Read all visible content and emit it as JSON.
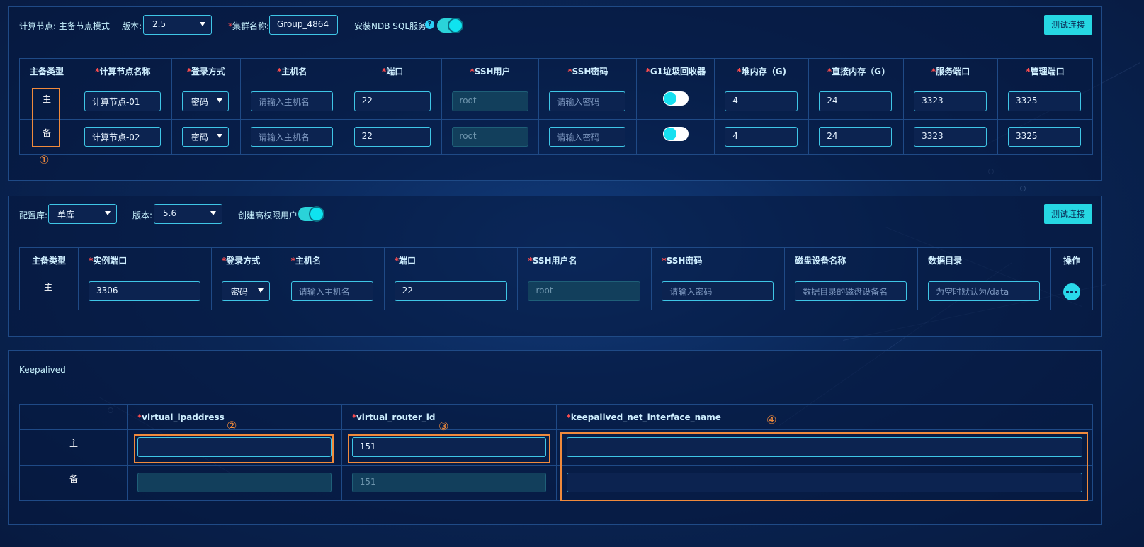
{
  "compute": {
    "label": "计算节点: 主备节点模式",
    "version_label": "版本:",
    "version_value": "2.5",
    "cluster_label": "集群名称:",
    "cluster_value": "Group_4864",
    "ndb_label": "安装NDB SQL服务",
    "ndb_help": "?",
    "ndb_toggle_on": true,
    "test_button": "测试连接",
    "columns": [
      "主备类型",
      "计算节点名称",
      "登录方式",
      "主机名",
      "端口",
      "SSH用户",
      "SSH密码",
      "G1垃圾回收器",
      "堆内存（G)",
      "直接内存（G)",
      "服务端口",
      "管理端口"
    ],
    "required": [
      false,
      true,
      true,
      true,
      true,
      true,
      true,
      true,
      true,
      true,
      true,
      true
    ],
    "rows": [
      {
        "type": "主",
        "name": "计算节点-01",
        "login": "密码",
        "host_placeholder": "请输入主机名",
        "port": "22",
        "ssh_user": "root",
        "ssh_pwd_placeholder": "请输入密码",
        "heap": "4",
        "direct": "24",
        "service_port": "3323",
        "manage_port": "3325"
      },
      {
        "type": "备",
        "name": "计算节点-02",
        "login": "密码",
        "host_placeholder": "请输入主机名",
        "port": "22",
        "ssh_user": "root",
        "ssh_pwd_placeholder": "请输入密码",
        "heap": "4",
        "direct": "24",
        "service_port": "3323",
        "manage_port": "3325"
      }
    ],
    "annotation": "①"
  },
  "config": {
    "db_label": "配置库:",
    "db_value": "单库",
    "version_label": "版本:",
    "version_value": "5.6",
    "priv_label": "创建高权限用户",
    "priv_toggle_on": true,
    "test_button": "测试连接",
    "columns": [
      "主备类型",
      "实例端口",
      "登录方式",
      "主机名",
      "端口",
      "SSH用户名",
      "SSH密码",
      "磁盘设备名称",
      "数据目录",
      "操作"
    ],
    "required": [
      false,
      true,
      true,
      true,
      true,
      true,
      true,
      false,
      false,
      false
    ],
    "row": {
      "type": "主",
      "instance_port": "3306",
      "login": "密码",
      "host_placeholder": "请输入主机名",
      "port": "22",
      "ssh_user": "root",
      "ssh_pwd_placeholder": "请输入密码",
      "disk_placeholder": "数据目录的磁盘设备名",
      "data_dir_placeholder": "为空时默认为/data"
    }
  },
  "keepalived": {
    "title": "Keepalived",
    "columns": [
      "",
      "virtual_ipaddress",
      "virtual_router_id",
      "keepalived_net_interface_name"
    ],
    "required": [
      false,
      true,
      true,
      true
    ],
    "rows": [
      {
        "type": "主",
        "vip": "",
        "router_id": "151",
        "iface": ""
      },
      {
        "type": "备",
        "vip": "",
        "router_id": "151",
        "iface": ""
      }
    ],
    "annotations": [
      "②",
      "③",
      "④"
    ]
  },
  "colors": {
    "accent": "#26d7e3",
    "annotation": "#f08a3c",
    "required": "#ff4d4f"
  }
}
